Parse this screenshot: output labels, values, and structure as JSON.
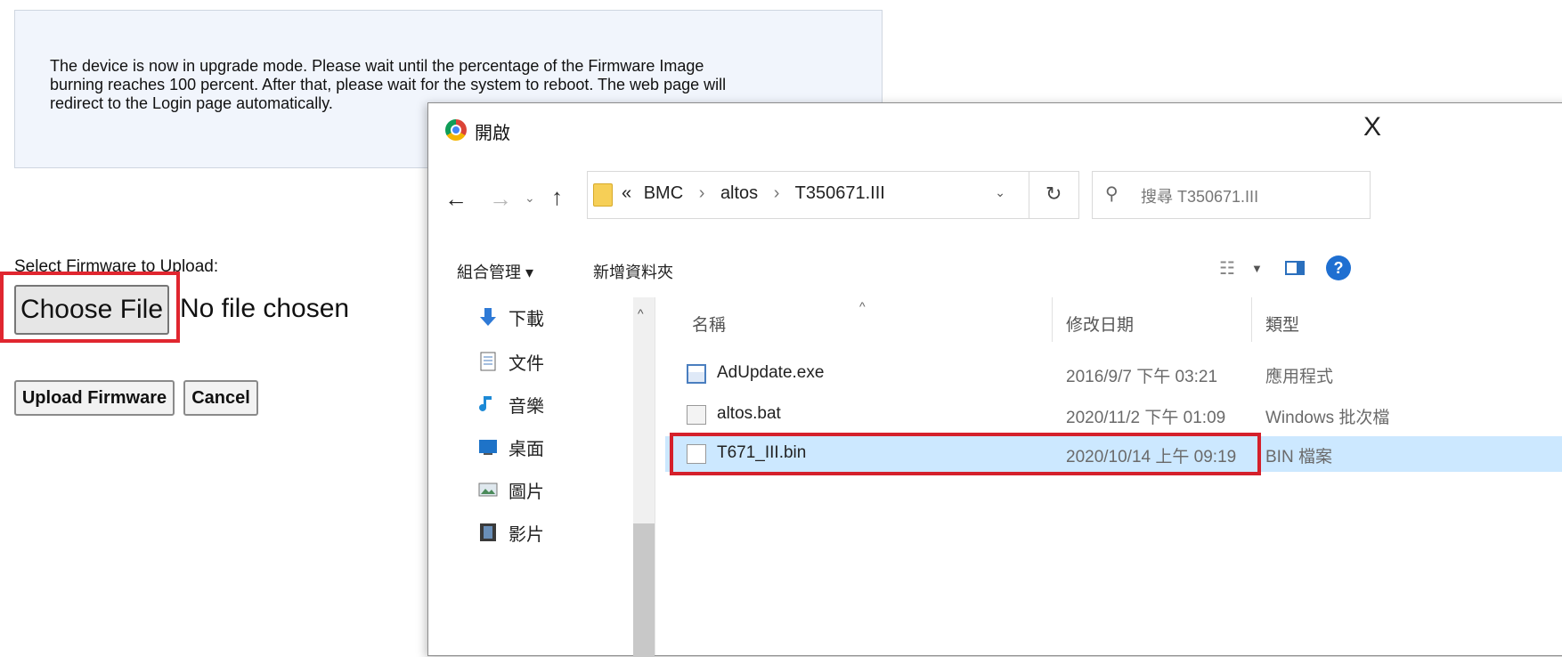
{
  "page": {
    "notice_text": "The device is now in upgrade mode. Please wait until the percentage of the Firmware Image burning reaches 100 percent. After that, please wait for the system to reboot. The web page will redirect to the Login page automatically.",
    "select_label": "Select Firmware to Upload:",
    "choose_file_label": "Choose File",
    "no_file_text": "No file chosen",
    "upload_label": "Upload Firmware",
    "cancel_label": "Cancel"
  },
  "dialog": {
    "title": "開啟",
    "close_glyph": "X",
    "nav": {
      "back": "←",
      "forward": "→",
      "recent": "⌄",
      "up": "↑"
    },
    "address": {
      "prefix": "«",
      "path": [
        "BMC",
        "altos",
        "T350671.III"
      ],
      "separator": "›",
      "dropdown": "⌄"
    },
    "refresh_glyph": "↻",
    "search_placeholder": "搜尋 T350671.III",
    "toolbar": {
      "organize": "組合管理 ▾",
      "new_folder": "新增資料夾",
      "help": "?"
    },
    "nav_pane": [
      {
        "label": "下載",
        "icon": "download-icon"
      },
      {
        "label": "文件",
        "icon": "document-icon"
      },
      {
        "label": "音樂",
        "icon": "music-icon"
      },
      {
        "label": "桌面",
        "icon": "desktop-icon"
      },
      {
        "label": "圖片",
        "icon": "pictures-icon"
      },
      {
        "label": "影片",
        "icon": "videos-icon"
      }
    ],
    "columns": {
      "name": "名稱",
      "date": "修改日期",
      "type": "類型",
      "sort_glyph": "^"
    },
    "files": [
      {
        "name": "AdUpdate.exe",
        "date": "2016/9/7 下午 03:21",
        "type": "應用程式",
        "icon": "exe-icon"
      },
      {
        "name": "altos.bat",
        "date": "2020/11/2 下午 01:09",
        "type": "Windows 批次檔",
        "icon": "bat-icon"
      },
      {
        "name": "T671_III.bin",
        "date": "2020/10/14 上午 09:19",
        "type": "BIN 檔案",
        "icon": "bin-icon",
        "selected": true
      }
    ]
  },
  "colors": {
    "highlight": "#e0262f",
    "selection": "#cce8ff",
    "notice_bg": "#f1f5fc"
  }
}
